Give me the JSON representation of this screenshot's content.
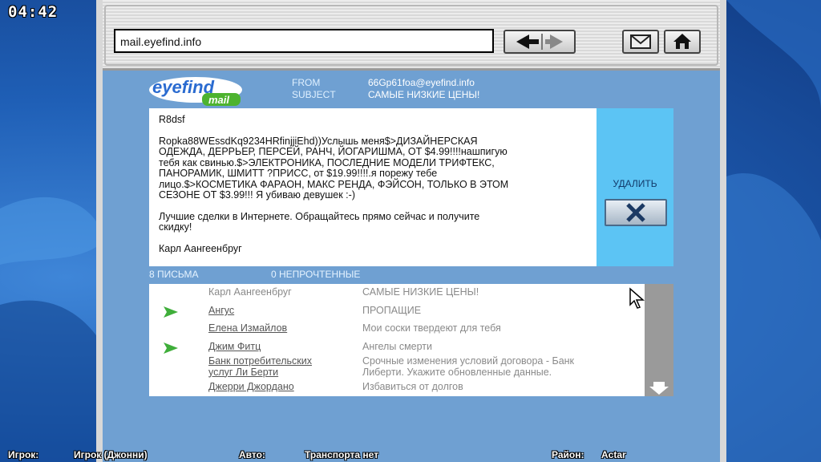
{
  "hud": {
    "clock": "04:42",
    "player_label": "Игрок:",
    "player_value": "Игрок (Джонни)",
    "vehicle_label": "Авто:",
    "vehicle_value": "Транспорта нет",
    "district_label": "Район:",
    "district_value": "Actar"
  },
  "browser": {
    "url": "mail.eyefind.info"
  },
  "header": {
    "logo_top": "eyefind",
    "logo_bottom": "mail",
    "from_label": "FROM",
    "from_value": "66Gp61foa@eyefind.info",
    "subject_label": "SUBJECT",
    "subject_value": "САМЫЕ НИЗКИЕ ЦЕНЫ!"
  },
  "message": {
    "p1": "R8dsf",
    "p2_lines": [
      "Ropka88WEssdKq9234HRfinjjiEhd))Услышь меня$>ДИЗАЙНЕРСКАЯ",
      "ОДЕЖДА, ДЕРРЬЕР, ПЕРСЕЙ, РАНЧ, ЙОГАРИШМА, ОТ $4.99!!!!нашпигую",
      "тебя как свинью.$>ЭЛЕКТРОНИКА, ПОСЛЕДНИЕ МОДЕЛИ ТРИФТЕКС,",
      "ПАНОРАМИК, ШМИТТ ?ПРИСС, от $19.99!!!!.я порежу тебе",
      "лицо.$>КОСМЕТИКА ФАРАОН, МАКС РЕНДА, ФЭЙСОН, ТОЛЬКО В ЭТОМ",
      "СЕЗОНЕ ОТ $3.99!!! Я убиваю девушек :-)"
    ],
    "p3_lines": [
      "Лучшие сделки в Интернете. Обращайтесь прямо сейчас и получите",
      "скидку!"
    ],
    "p4": "Карл Аангеенбруг"
  },
  "side": {
    "delete_label": "УДАЛИТЬ"
  },
  "counts": {
    "letters": "8 ПИСЬМА",
    "unread": "0 НЕПРОЧТЕННЫЕ"
  },
  "inbox": [
    {
      "sender": [
        "Карл Аангеенбруг"
      ],
      "subject": [
        "САМЫЕ НИЗКИЕ ЦЕНЫ!"
      ],
      "flag": false,
      "link": false
    },
    {
      "sender": [
        "Ангус"
      ],
      "subject": [
        "ПРОПАЩИЕ"
      ],
      "flag": true,
      "link": true
    },
    {
      "sender": [
        "Елена Измайлов"
      ],
      "subject": [
        "Мои соски твердеют для тебя"
      ],
      "flag": false,
      "link": true
    },
    {
      "sender": [
        "Джим Фитц"
      ],
      "subject": [
        "Ангелы смерти"
      ],
      "flag": true,
      "link": true
    },
    {
      "sender": [
        "Банк потребительских",
        "услуг Ли Берти"
      ],
      "subject": [
        "Срочные изменения условий договора - Банк",
        "Либерти. Укажите обновленные данные."
      ],
      "flag": false,
      "link": true
    },
    {
      "sender": [
        "Джерри Джордано"
      ],
      "subject": [
        "Избавиться от долгов"
      ],
      "flag": false,
      "link": true
    }
  ],
  "colors": {
    "window_bg": "#6fa0d2",
    "side_panel": "#5cc4f4",
    "flag_green": "#3fae3a",
    "desktop": "#1f5fb6"
  }
}
